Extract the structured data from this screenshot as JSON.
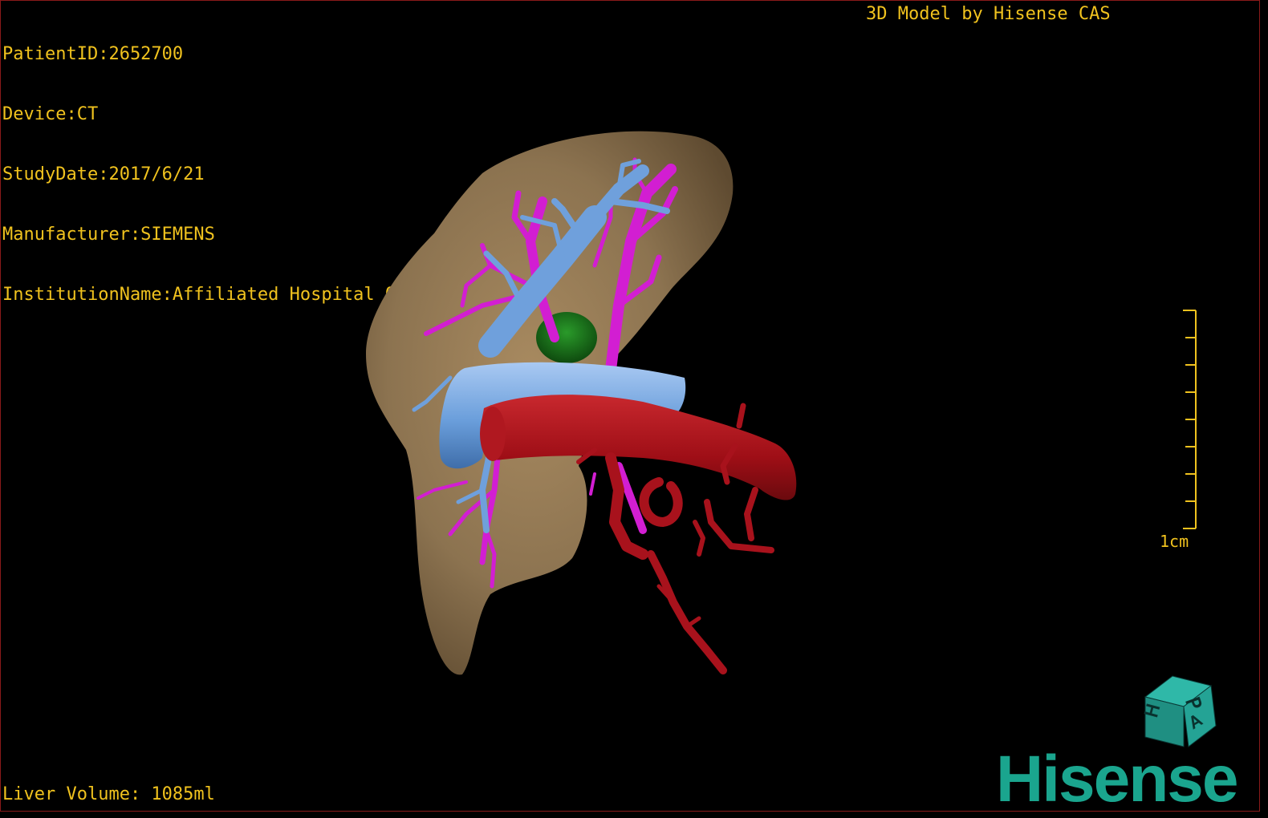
{
  "header": {
    "patient_id": "PatientID:2652700",
    "device": "Device:CT",
    "study_date": "StudyDate:2017/6/21",
    "manufacturer": "Manufacturer:SIEMENS",
    "institution": "InstitutionName:Affiliated Hospital Qingdao University-C"
  },
  "credit": "3D Model by Hisense CAS",
  "footer": {
    "liver_volume": "Liver Volume: 1085ml"
  },
  "scale_bar": {
    "label": "1cm"
  },
  "orientation_cube": {
    "faces": [
      "P",
      "H",
      "A"
    ]
  },
  "brand": {
    "name": "Hisense"
  },
  "colors": {
    "overlay_text": "#f0c21e",
    "liver": "#8c7350",
    "portal_vein": "#6fa0dc",
    "hepatic_vein": "#d21ed2",
    "artery": "#a0101a",
    "gallbladder": "#1a6e1a",
    "brand": "#1aa58e",
    "border": "#8a1a1a"
  }
}
